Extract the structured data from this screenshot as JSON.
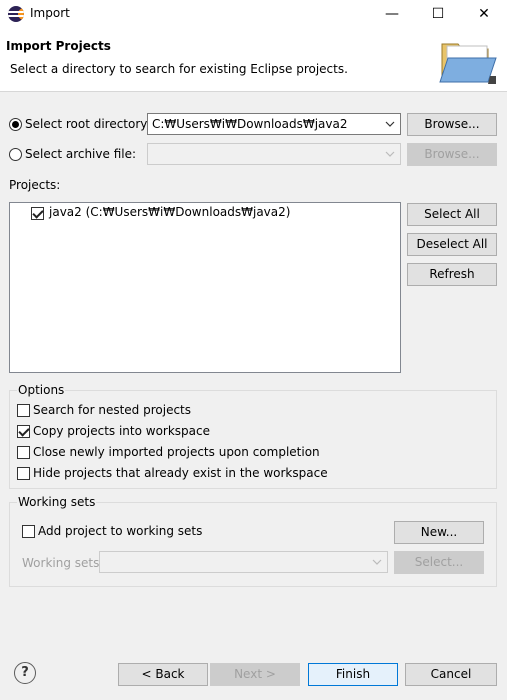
{
  "window": {
    "title": "Import"
  },
  "window_controls": {
    "minimize": "—",
    "maximize": "☐",
    "close": "✕"
  },
  "header": {
    "title": "Import Projects",
    "description": "Select a directory to search for existing Eclipse projects."
  },
  "source": {
    "root_label": "Select root directory:",
    "root_path": "C:₩Users₩i₩Downloads₩java2",
    "archive_label": "Select archive file:",
    "archive_path": "",
    "browse_label": "Browse..."
  },
  "projects": {
    "label": "Projects:",
    "items": [
      {
        "label": "java2 (C:₩Users₩i₩Downloads₩java2)",
        "checked": true
      }
    ],
    "select_all": "Select All",
    "deselect_all": "Deselect All",
    "refresh": "Refresh"
  },
  "options": {
    "legend": "Options",
    "items": [
      {
        "label": "Search for nested projects",
        "checked": false
      },
      {
        "label": "Copy projects into workspace",
        "checked": true
      },
      {
        "label": "Close newly imported projects upon completion",
        "checked": false
      },
      {
        "label": "Hide projects that already exist in the workspace",
        "checked": false
      }
    ]
  },
  "working_sets": {
    "legend": "Working sets",
    "add_label": "Add project to working sets",
    "add_checked": false,
    "new_button": "New...",
    "sets_label": "Working sets:",
    "select_button": "Select..."
  },
  "footer": {
    "help": "?",
    "back": "< Back",
    "next": "Next >",
    "finish": "Finish",
    "cancel": "Cancel"
  }
}
